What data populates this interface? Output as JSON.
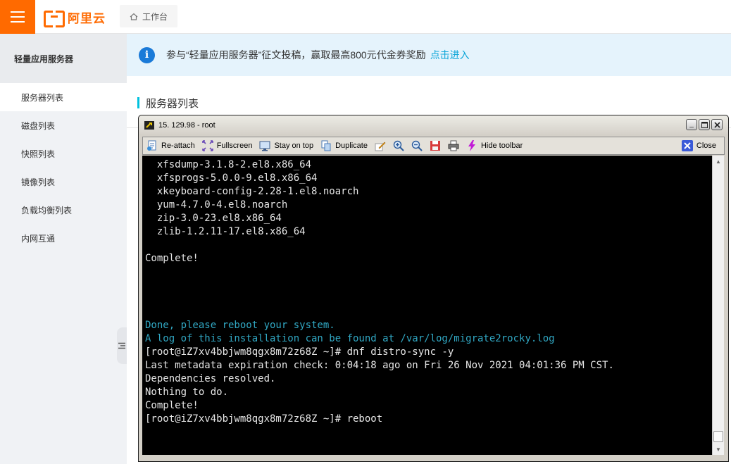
{
  "topbar": {
    "logo_text": "阿里云",
    "workbench_label": "工作台"
  },
  "sidebar": {
    "title": "轻量应用服务器",
    "items": [
      {
        "label": "服务器列表"
      },
      {
        "label": "磁盘列表"
      },
      {
        "label": "快照列表"
      },
      {
        "label": "镜像列表"
      },
      {
        "label": "负载均衡列表"
      },
      {
        "label": "内网互通"
      }
    ]
  },
  "notice": {
    "icon": "i",
    "text": "参与“轻量应用服务器”征文投稿，赢取最高800元代金券奖励",
    "link": "点击进入"
  },
  "section": {
    "title": "服务器列表"
  },
  "terminal_window": {
    "title": "15. 129.98  - root",
    "toolbar": {
      "reattach": "Re-attach",
      "fullscreen": "Fullscreen",
      "stay_on_top": "Stay on top",
      "duplicate": "Duplicate",
      "hide_toolbar": "Hide toolbar",
      "close": "Close"
    },
    "lines": [
      {
        "text": "  xfsdump-3.1.8-2.el8.x86_64",
        "color": "default"
      },
      {
        "text": "  xfsprogs-5.0.0-9.el8.x86_64",
        "color": "default"
      },
      {
        "text": "  xkeyboard-config-2.28-1.el8.noarch",
        "color": "default"
      },
      {
        "text": "  yum-4.7.0-4.el8.noarch",
        "color": "default"
      },
      {
        "text": "  zip-3.0-23.el8.x86_64",
        "color": "default"
      },
      {
        "text": "  zlib-1.2.11-17.el8.x86_64",
        "color": "default"
      },
      {
        "text": "",
        "color": "default"
      },
      {
        "text": "Complete!",
        "color": "default"
      },
      {
        "text": "",
        "color": "default"
      },
      {
        "text": "",
        "color": "default"
      },
      {
        "text": "",
        "color": "default"
      },
      {
        "text": "",
        "color": "default"
      },
      {
        "text": "Done, please reboot your system.",
        "color": "cyan"
      },
      {
        "text": "A log of this installation can be found at /var/log/migrate2rocky.log",
        "color": "cyan"
      },
      {
        "text": "[root@iZ7xv4bbjwm8qgx8m72z68Z ~]# dnf distro-sync -y",
        "color": "default"
      },
      {
        "text": "Last metadata expiration check: 0:04:18 ago on Fri 26 Nov 2021 04:01:36 PM CST.",
        "color": "default"
      },
      {
        "text": "Dependencies resolved.",
        "color": "default"
      },
      {
        "text": "Nothing to do.",
        "color": "default"
      },
      {
        "text": "Complete!",
        "color": "default"
      },
      {
        "text": "[root@iZ7xv4bbjwm8qgx8m72z68Z ~]# reboot",
        "color": "default"
      }
    ]
  },
  "colors": {
    "brand": "#ff6a00",
    "accent": "#00c1de",
    "link": "#0aa5d8",
    "terminal_cyan": "#31a8c4"
  }
}
